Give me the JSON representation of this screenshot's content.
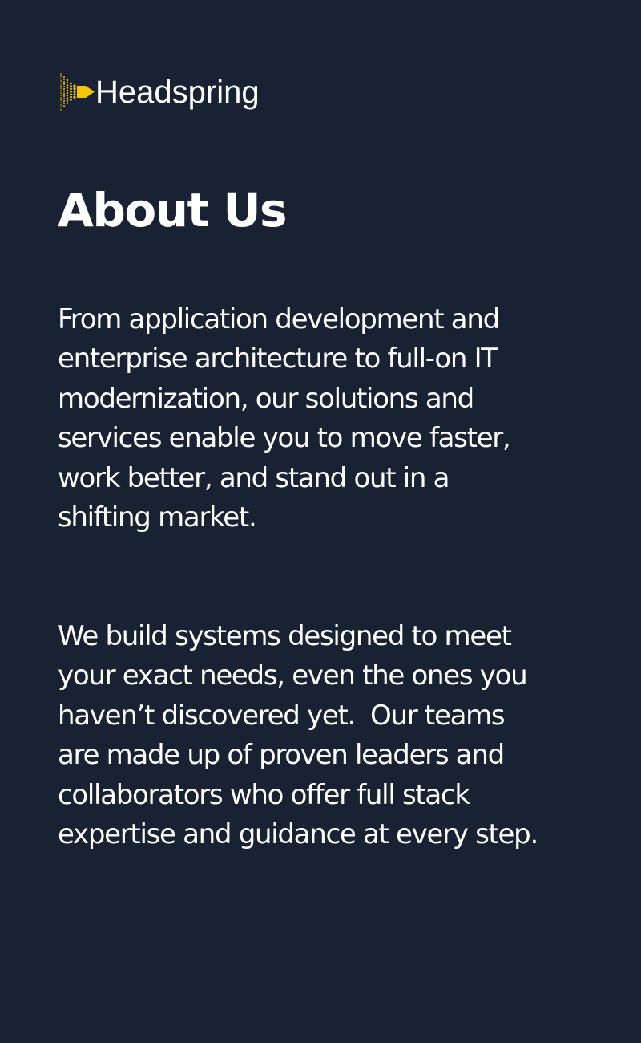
{
  "brand": {
    "name": "Headspring",
    "logo_icon": "headspring-arrow-logo-icon",
    "accent_color": "#F5C400",
    "background_color": "#182232",
    "text_color": "#FFFFFF"
  },
  "page": {
    "title": "About Us",
    "paragraphs": [
      {
        "lines": [
          "From application development and",
          "enterprise architecture to full-on IT",
          "modernization, our solutions and",
          "services enable you to move faster,",
          "work better, and stand out in a",
          "shifting market."
        ]
      },
      {
        "lines": [
          "We build systems designed to meet",
          "your exact needs, even the ones you",
          "haven’t discovered yet.  Our teams",
          "are made up of proven leaders and",
          "collaborators who offer full stack",
          "expertise and guidance at every step."
        ]
      }
    ]
  }
}
